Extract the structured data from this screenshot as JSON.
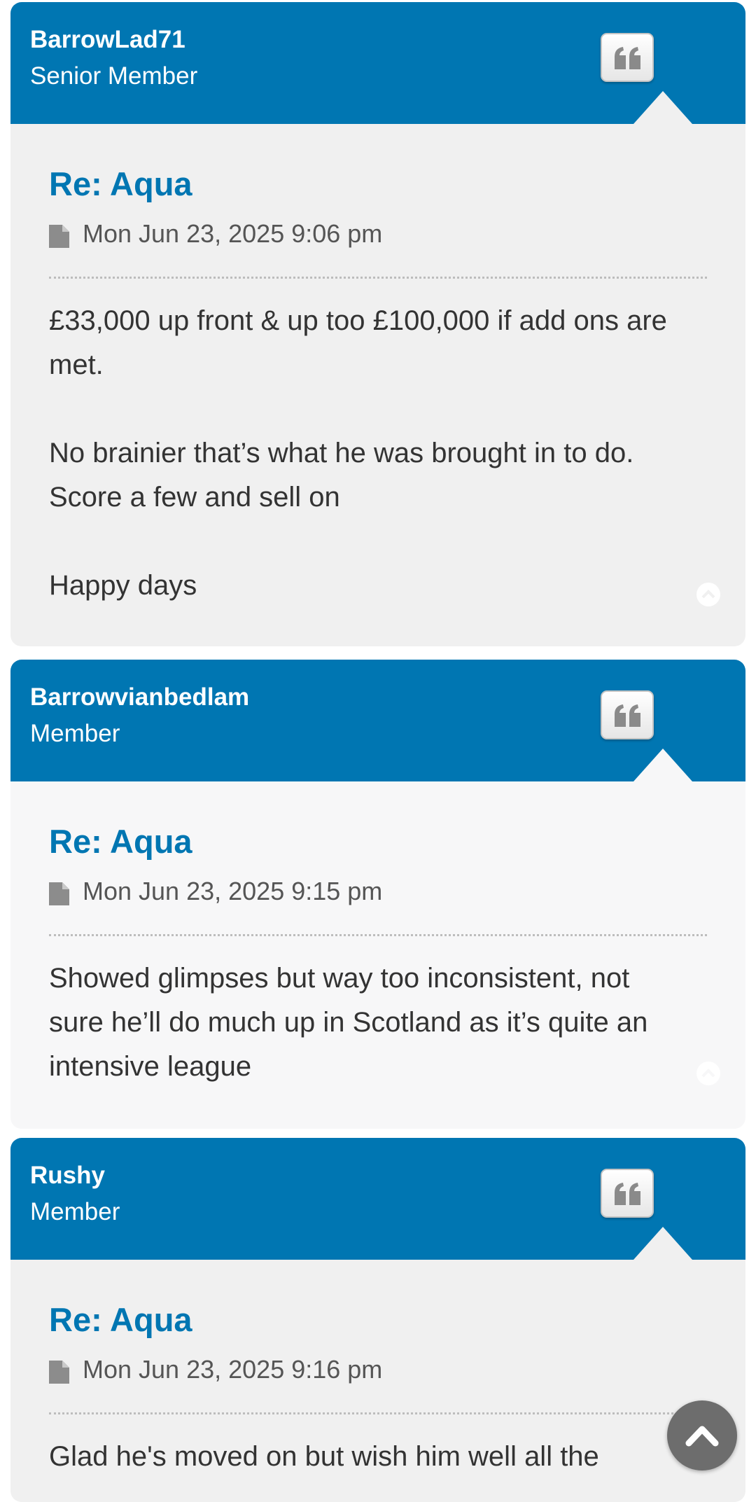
{
  "posts": [
    {
      "username": "BarrowLad71",
      "rank": "Senior Member",
      "title": "Re: Aqua",
      "date": "Mon Jun 23, 2025 9:06 pm",
      "paragraphs": [
        [
          "£33,000 up front & up too £100,000 if add ons are",
          "met."
        ],
        [
          "No brainier that’s what he was brought in to do.",
          "Score a few and sell on"
        ],
        [
          "Happy days"
        ]
      ]
    },
    {
      "username": "Barrowvianbedlam",
      "rank": "Member",
      "title": "Re: Aqua",
      "date": "Mon Jun 23, 2025 9:15 pm",
      "paragraphs": [
        [
          "Showed glimpses but way too inconsistent, not",
          "sure he’ll do much up in Scotland as it’s quite an",
          "intensive league"
        ]
      ]
    },
    {
      "username": "Rushy",
      "rank": "Member",
      "title": "Re: Aqua",
      "date": "Mon Jun 23, 2025 9:16 pm",
      "paragraphs": [
        [
          "Glad he's moved on but wish him well all the"
        ]
      ]
    }
  ],
  "colors": {
    "header": "#0076b2",
    "title": "#0076b2",
    "body_alt_1": "#f0f0f0",
    "body_alt_2": "#f7f7f8",
    "fab": "#6d6d6d"
  },
  "icons": {
    "quote": "quote-icon",
    "file": "file-icon",
    "back_to_top": "chevron-up-icon",
    "scroll_top": "chevron-up-circle-icon"
  }
}
